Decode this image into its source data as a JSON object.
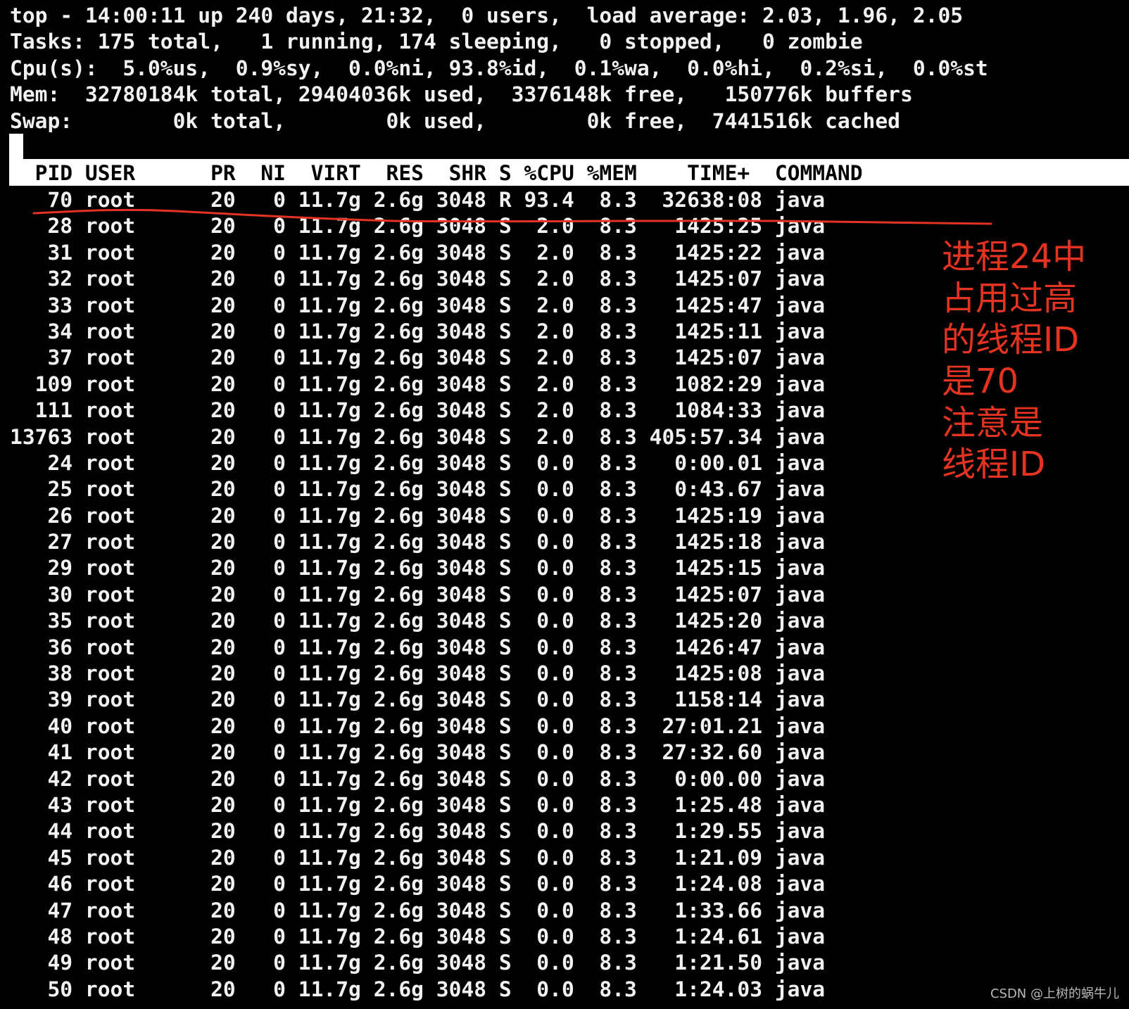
{
  "summary": {
    "line1": "top - 14:00:11 up 240 days, 21:32,  0 users,  load average: 2.03, 1.96, 2.05",
    "line2": "Tasks: 175 total,   1 running, 174 sleeping,   0 stopped,   0 zombie",
    "line3": "Cpu(s):  5.0%us,  0.9%sy,  0.0%ni, 93.8%id,  0.1%wa,  0.0%hi,  0.2%si,  0.0%st",
    "line4": "Mem:  32780184k total, 29404036k used,  3376148k free,   150776k buffers",
    "line5": "Swap:        0k total,        0k used,        0k free,  7441516k cached"
  },
  "table": {
    "header": "  PID USER      PR  NI  VIRT  RES  SHR S %CPU %MEM    TIME+  COMMAND",
    "rows": [
      "   70 root      20   0 11.7g 2.6g 3048 R 93.4  8.3  32638:08 java",
      "   28 root      20   0 11.7g 2.6g 3048 S  2.0  8.3   1425:25 java",
      "   31 root      20   0 11.7g 2.6g 3048 S  2.0  8.3   1425:22 java",
      "   32 root      20   0 11.7g 2.6g 3048 S  2.0  8.3   1425:07 java",
      "   33 root      20   0 11.7g 2.6g 3048 S  2.0  8.3   1425:47 java",
      "   34 root      20   0 11.7g 2.6g 3048 S  2.0  8.3   1425:11 java",
      "   37 root      20   0 11.7g 2.6g 3048 S  2.0  8.3   1425:07 java",
      "  109 root      20   0 11.7g 2.6g 3048 S  2.0  8.3   1082:29 java",
      "  111 root      20   0 11.7g 2.6g 3048 S  2.0  8.3   1084:33 java",
      "13763 root      20   0 11.7g 2.6g 3048 S  2.0  8.3 405:57.34 java",
      "   24 root      20   0 11.7g 2.6g 3048 S  0.0  8.3   0:00.01 java",
      "   25 root      20   0 11.7g 2.6g 3048 S  0.0  8.3   0:43.67 java",
      "   26 root      20   0 11.7g 2.6g 3048 S  0.0  8.3   1425:19 java",
      "   27 root      20   0 11.7g 2.6g 3048 S  0.0  8.3   1425:18 java",
      "   29 root      20   0 11.7g 2.6g 3048 S  0.0  8.3   1425:15 java",
      "   30 root      20   0 11.7g 2.6g 3048 S  0.0  8.3   1425:07 java",
      "   35 root      20   0 11.7g 2.6g 3048 S  0.0  8.3   1425:20 java",
      "   36 root      20   0 11.7g 2.6g 3048 S  0.0  8.3   1426:47 java",
      "   38 root      20   0 11.7g 2.6g 3048 S  0.0  8.3   1425:08 java",
      "   39 root      20   0 11.7g 2.6g 3048 S  0.0  8.3   1158:14 java",
      "   40 root      20   0 11.7g 2.6g 3048 S  0.0  8.3  27:01.21 java",
      "   41 root      20   0 11.7g 2.6g 3048 S  0.0  8.3  27:32.60 java",
      "   42 root      20   0 11.7g 2.6g 3048 S  0.0  8.3   0:00.00 java",
      "   43 root      20   0 11.7g 2.6g 3048 S  0.0  8.3   1:25.48 java",
      "   44 root      20   0 11.7g 2.6g 3048 S  0.0  8.3   1:29.55 java",
      "   45 root      20   0 11.7g 2.6g 3048 S  0.0  8.3   1:21.09 java",
      "   46 root      20   0 11.7g 2.6g 3048 S  0.0  8.3   1:24.08 java",
      "   47 root      20   0 11.7g 2.6g 3048 S  0.0  8.3   1:33.66 java",
      "   48 root      20   0 11.7g 2.6g 3048 S  0.0  8.3   1:24.61 java",
      "   49 root      20   0 11.7g 2.6g 3048 S  0.0  8.3   1:21.50 java",
      "   50 root      20   0 11.7g 2.6g 3048 S  0.0  8.3   1:24.03 java"
    ]
  },
  "annotation": {
    "lines": [
      "进程24中",
      "占用过高",
      "的线程ID",
      "是70",
      "注意是",
      "线程ID"
    ],
    "color": "#e53322"
  },
  "watermark": "CSDN @上树的蜗牛儿",
  "colors": {
    "background": "#000000",
    "text": "#f2f2f2",
    "header_bar": "#ffffff",
    "header_text": "#000000",
    "underline": "#e53322"
  }
}
